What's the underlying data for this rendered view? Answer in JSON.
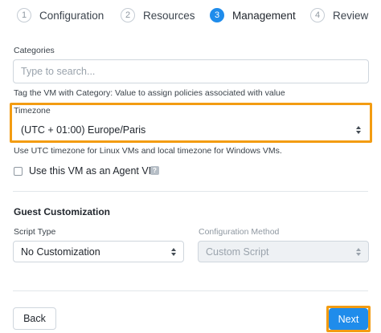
{
  "stepper": {
    "steps": [
      {
        "num": "1",
        "label": "Configuration"
      },
      {
        "num": "2",
        "label": "Resources"
      },
      {
        "num": "3",
        "label": "Management"
      },
      {
        "num": "4",
        "label": "Review"
      }
    ],
    "active_step": "3",
    "accent_color": "#1f8ceb"
  },
  "categories": {
    "label": "Categories",
    "placeholder": "Type to search...",
    "help": "Tag the VM with Category: Value to assign policies associated with value"
  },
  "timezone": {
    "label": "Timezone",
    "value": "(UTC + 01:00) Europe/Paris",
    "help": "Use UTC timezone for Linux VMs and local timezone for Windows VMs.",
    "highlight_color": "#f39c12"
  },
  "agent_vm": {
    "label": "Use this VM as an Agent VM",
    "checked": false,
    "help_icon": "question-icon",
    "help_glyph": "?"
  },
  "guest_customization": {
    "title": "Guest Customization",
    "script_type": {
      "label": "Script Type",
      "value": "No Customization"
    },
    "configuration_method": {
      "label": "Configuration Method",
      "value": "Custom Script",
      "disabled": true
    }
  },
  "footer": {
    "back_label": "Back",
    "next_label": "Next"
  }
}
